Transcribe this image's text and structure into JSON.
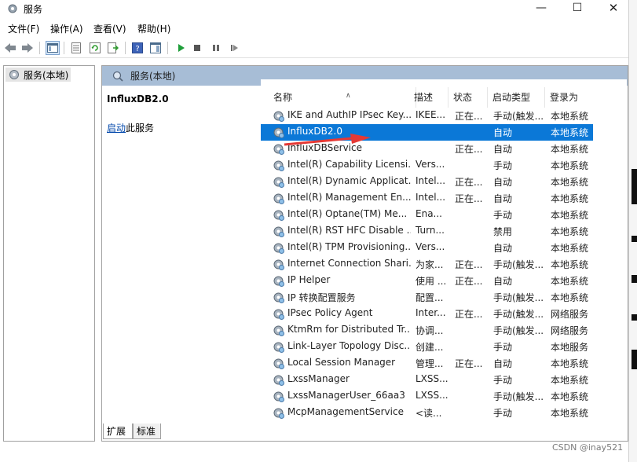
{
  "window": {
    "title": "服务",
    "min_label": "—",
    "max_label": "☐",
    "close_label": "✕"
  },
  "menu": {
    "items": [
      "文件(F)",
      "操作(A)",
      "查看(V)",
      "帮助(H)"
    ]
  },
  "tree": {
    "root_label": "服务(本地)"
  },
  "main": {
    "header": "服务(本地)",
    "detail_title": "InfluxDB2.0",
    "detail_action_link": "启动",
    "detail_action_rest": "此服务"
  },
  "columns": {
    "name": "名称",
    "desc": "描述",
    "status": "状态",
    "start": "启动类型",
    "logon": "登录为"
  },
  "rows": [
    {
      "name": "IKE and AuthIP IPsec Key...",
      "desc": "IKEE...",
      "status": "正在...",
      "start": "手动(触发...",
      "logon": "本地系统"
    },
    {
      "name": "InfluxDB2.0",
      "desc": "",
      "status": "",
      "start": "自动",
      "logon": "本地系统"
    },
    {
      "name": "InfluxDBService",
      "desc": "",
      "status": "正在...",
      "start": "自动",
      "logon": "本地系统"
    },
    {
      "name": "Intel(R) Capability Licensi...",
      "desc": "Vers...",
      "status": "",
      "start": "手动",
      "logon": "本地系统"
    },
    {
      "name": "Intel(R) Dynamic Applicat...",
      "desc": "Intel...",
      "status": "正在...",
      "start": "自动",
      "logon": "本地系统"
    },
    {
      "name": "Intel(R) Management En...",
      "desc": "Intel...",
      "status": "正在...",
      "start": "自动",
      "logon": "本地系统"
    },
    {
      "name": "Intel(R) Optane(TM) Me...",
      "desc": "Ena...",
      "status": "",
      "start": "手动",
      "logon": "本地系统"
    },
    {
      "name": "Intel(R) RST HFC Disable ...",
      "desc": "Turn...",
      "status": "",
      "start": "禁用",
      "logon": "本地系统"
    },
    {
      "name": "Intel(R) TPM Provisioning...",
      "desc": "Vers...",
      "status": "",
      "start": "自动",
      "logon": "本地系统"
    },
    {
      "name": "Internet Connection Shari...",
      "desc": "为家...",
      "status": "正在...",
      "start": "手动(触发...",
      "logon": "本地系统"
    },
    {
      "name": "IP Helper",
      "desc": "使用 ...",
      "status": "正在...",
      "start": "自动",
      "logon": "本地系统"
    },
    {
      "name": "IP 转换配置服务",
      "desc": "配置...",
      "status": "",
      "start": "手动(触发...",
      "logon": "本地系统"
    },
    {
      "name": "IPsec Policy Agent",
      "desc": "Inter...",
      "status": "正在...",
      "start": "手动(触发...",
      "logon": "网络服务"
    },
    {
      "name": "KtmRm for Distributed Tr...",
      "desc": "协调...",
      "status": "",
      "start": "手动(触发...",
      "logon": "网络服务"
    },
    {
      "name": "Link-Layer Topology Disc...",
      "desc": "创建...",
      "status": "",
      "start": "手动",
      "logon": "本地服务"
    },
    {
      "name": "Local Session Manager",
      "desc": "管理...",
      "status": "正在...",
      "start": "自动",
      "logon": "本地系统"
    },
    {
      "name": "LxssManager",
      "desc": "LXSS...",
      "status": "",
      "start": "手动",
      "logon": "本地系统"
    },
    {
      "name": "LxssManagerUser_66aa3",
      "desc": "LXSS...",
      "status": "",
      "start": "手动(触发...",
      "logon": "本地系统"
    },
    {
      "name": "McpManagementService",
      "desc": "<读...",
      "status": "",
      "start": "手动",
      "logon": "本地系统"
    }
  ],
  "selected_row": 1,
  "tabs": {
    "extended": "扩展",
    "standard": "标准"
  },
  "watermark": "CSDN @inay521",
  "colors": {
    "selection": "#0b78d7",
    "header_bar": "#a7bdd6",
    "annotation_arrow": "#e53935"
  }
}
